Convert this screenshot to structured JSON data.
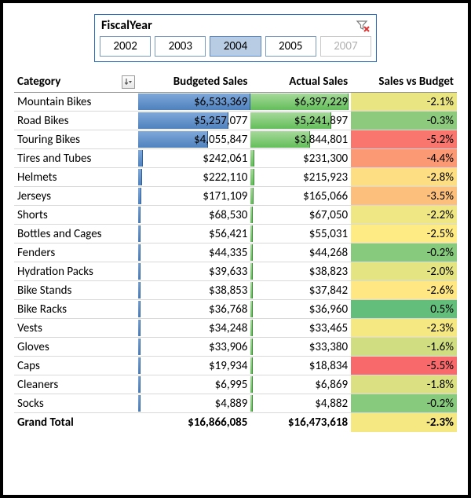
{
  "slicer": {
    "title": "FiscalYear",
    "items": [
      {
        "label": "2002",
        "state": "normal"
      },
      {
        "label": "2003",
        "state": "normal"
      },
      {
        "label": "2004",
        "state": "selected"
      },
      {
        "label": "2005",
        "state": "normal"
      },
      {
        "label": "2007",
        "state": "nodata"
      }
    ]
  },
  "columns": {
    "category": "Category",
    "budgeted": "Budgeted Sales",
    "actual": "Actual Sales",
    "variance": "Sales vs Budget"
  },
  "max_bar_value": 6533369,
  "rows": [
    {
      "cat": "Mountain Bikes",
      "bud": 6533369,
      "budf": "$6,533,369",
      "act": 6397229,
      "actf": "$6,397,229",
      "var": -2.1,
      "varf": "-2.1%"
    },
    {
      "cat": "Road Bikes",
      "bud": 5257077,
      "budf": "$5,257,077",
      "act": 5241897,
      "actf": "$5,241,897",
      "var": -0.3,
      "varf": "-0.3%"
    },
    {
      "cat": "Touring Bikes",
      "bud": 4055847,
      "budf": "$4,055,847",
      "act": 3844801,
      "actf": "$3,844,801",
      "var": -5.2,
      "varf": "-5.2%"
    },
    {
      "cat": "Tires and Tubes",
      "bud": 242061,
      "budf": "$242,061",
      "act": 231300,
      "actf": "$231,300",
      "var": -4.4,
      "varf": "-4.4%"
    },
    {
      "cat": "Helmets",
      "bud": 222110,
      "budf": "$222,110",
      "act": 215923,
      "actf": "$215,923",
      "var": -2.8,
      "varf": "-2.8%"
    },
    {
      "cat": "Jerseys",
      "bud": 171109,
      "budf": "$171,109",
      "act": 165066,
      "actf": "$165,066",
      "var": -3.5,
      "varf": "-3.5%"
    },
    {
      "cat": "Shorts",
      "bud": 68530,
      "budf": "$68,530",
      "act": 67050,
      "actf": "$67,050",
      "var": -2.2,
      "varf": "-2.2%"
    },
    {
      "cat": "Bottles and Cages",
      "bud": 56421,
      "budf": "$56,421",
      "act": 55031,
      "actf": "$55,031",
      "var": -2.5,
      "varf": "-2.5%"
    },
    {
      "cat": "Fenders",
      "bud": 44335,
      "budf": "$44,335",
      "act": 44268,
      "actf": "$44,268",
      "var": -0.2,
      "varf": "-0.2%"
    },
    {
      "cat": "Hydration Packs",
      "bud": 39633,
      "budf": "$39,633",
      "act": 38823,
      "actf": "$38,823",
      "var": -2.0,
      "varf": "-2.0%"
    },
    {
      "cat": "Bike Stands",
      "bud": 38853,
      "budf": "$38,853",
      "act": 37842,
      "actf": "$37,842",
      "var": -2.6,
      "varf": "-2.6%"
    },
    {
      "cat": "Bike Racks",
      "bud": 36768,
      "budf": "$36,768",
      "act": 36960,
      "actf": "$36,960",
      "var": 0.5,
      "varf": "0.5%"
    },
    {
      "cat": "Vests",
      "bud": 34248,
      "budf": "$34,248",
      "act": 33465,
      "actf": "$33,465",
      "var": -2.3,
      "varf": "-2.3%"
    },
    {
      "cat": "Gloves",
      "bud": 33906,
      "budf": "$33,906",
      "act": 33380,
      "actf": "$33,380",
      "var": -1.6,
      "varf": "-1.6%"
    },
    {
      "cat": "Caps",
      "bud": 19934,
      "budf": "$19,934",
      "act": 18834,
      "actf": "$18,834",
      "var": -5.5,
      "varf": "-5.5%"
    },
    {
      "cat": "Cleaners",
      "bud": 6995,
      "budf": "$6,995",
      "act": 6869,
      "actf": "$6,869",
      "var": -1.8,
      "varf": "-1.8%"
    },
    {
      "cat": "Socks",
      "bud": 4889,
      "budf": "$4,889",
      "act": 4882,
      "actf": "$4,882",
      "var": -0.2,
      "varf": "-0.2%"
    }
  ],
  "total": {
    "label": "Grand Total",
    "budf": "$16,866,085",
    "actf": "$16,473,618",
    "var": -2.3,
    "varf": "-2.3%"
  },
  "heatmap": {
    "min": -5.5,
    "max": 0.5,
    "colors": {
      "low": "#f8696b",
      "mid": "#ffeb84",
      "high": "#63be7b"
    }
  },
  "chart_data": {
    "type": "table",
    "title": "Budgeted vs Actual Sales by Category (FiscalYear 2004)",
    "columns": [
      "Category",
      "Budgeted Sales",
      "Actual Sales",
      "Sales vs Budget %"
    ],
    "rows": [
      [
        "Mountain Bikes",
        6533369,
        6397229,
        -2.1
      ],
      [
        "Road Bikes",
        5257077,
        5241897,
        -0.3
      ],
      [
        "Touring Bikes",
        4055847,
        3844801,
        -5.2
      ],
      [
        "Tires and Tubes",
        242061,
        231300,
        -4.4
      ],
      [
        "Helmets",
        222110,
        215923,
        -2.8
      ],
      [
        "Jerseys",
        171109,
        165066,
        -3.5
      ],
      [
        "Shorts",
        68530,
        67050,
        -2.2
      ],
      [
        "Bottles and Cages",
        56421,
        55031,
        -2.5
      ],
      [
        "Fenders",
        44335,
        44268,
        -0.2
      ],
      [
        "Hydration Packs",
        39633,
        38823,
        -2.0
      ],
      [
        "Bike Stands",
        38853,
        37842,
        -2.6
      ],
      [
        "Bike Racks",
        36768,
        36960,
        0.5
      ],
      [
        "Vests",
        34248,
        33465,
        -2.3
      ],
      [
        "Gloves",
        33906,
        33380,
        -1.6
      ],
      [
        "Caps",
        19934,
        18834,
        -5.5
      ],
      [
        "Cleaners",
        6995,
        6869,
        -1.8
      ],
      [
        "Socks",
        4889,
        4882,
        -0.2
      ]
    ],
    "grand_total": [
      "Grand Total",
      16866085,
      16473618,
      -2.3
    ]
  }
}
